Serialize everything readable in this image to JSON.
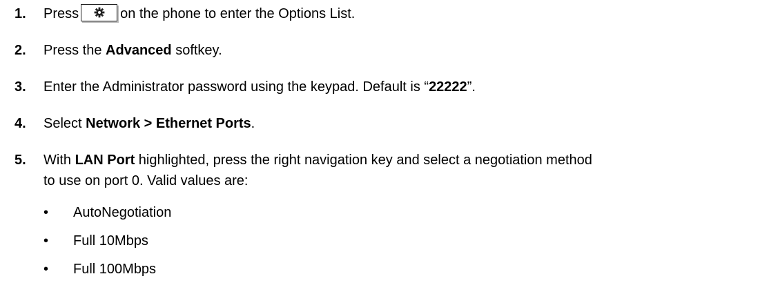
{
  "steps": [
    {
      "number": "1.",
      "before": "Press",
      "key_icon": "gear-icon",
      "after": "on the phone to enter the Options List."
    },
    {
      "number": "2.",
      "before": "Press the ",
      "bold": "Advanced",
      "after": " softkey."
    },
    {
      "number": "3.",
      "before": "Enter the Administrator password using the keypad. Default is “",
      "bold": "22222",
      "after": "”."
    },
    {
      "number": "4.",
      "before": "Select ",
      "bold": "Network > Ethernet Ports",
      "after": "."
    },
    {
      "number": "5.",
      "before": "With ",
      "bold": "LAN Port",
      "after": " highlighted, press the right navigation key and select a negotiation method",
      "continuation": "to use on port 0. Valid values are:"
    }
  ],
  "values": {
    "bullet": "•",
    "items": [
      "AutoNegotiation",
      "Full 10Mbps",
      "Full 100Mbps"
    ]
  }
}
